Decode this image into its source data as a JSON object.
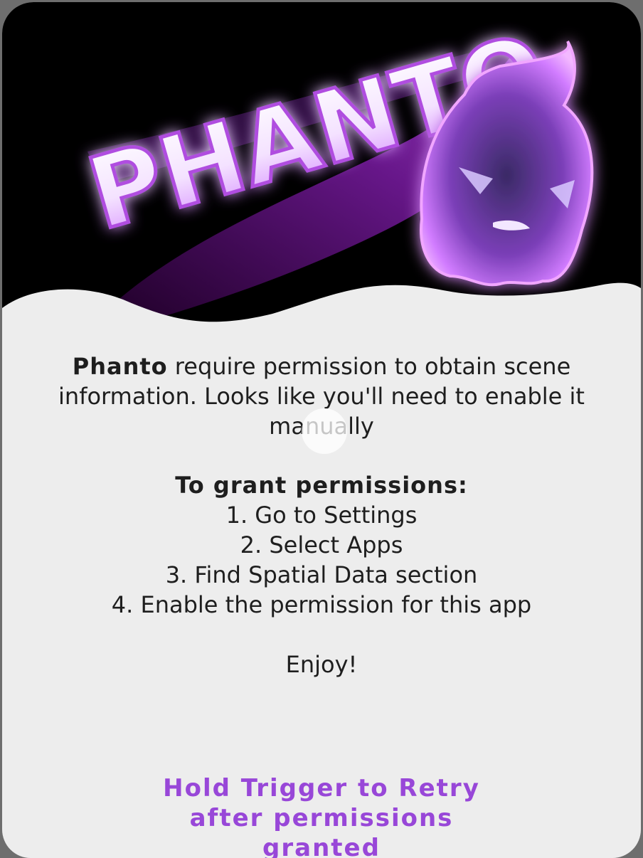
{
  "banner": {
    "logo_text": "PHANTO",
    "accent": "#c04bff",
    "background": "#000000"
  },
  "message": {
    "brand": "Phanto",
    "text_part1": " require permission to obtain scene",
    "text_part2": "information. Looks like you'll need to enable it",
    "text_part3": "manually"
  },
  "instructions": {
    "heading": "To grant permissions:",
    "steps": [
      "1. Go to Settings",
      "2. Select Apps",
      "3. Find Spatial Data section",
      "4. Enable the permission for this app"
    ],
    "closing": "Enjoy!"
  },
  "retry": {
    "line1": "Hold Trigger to Retry",
    "line2": "after permissions",
    "line3": "granted",
    "color": "#9847d8"
  }
}
